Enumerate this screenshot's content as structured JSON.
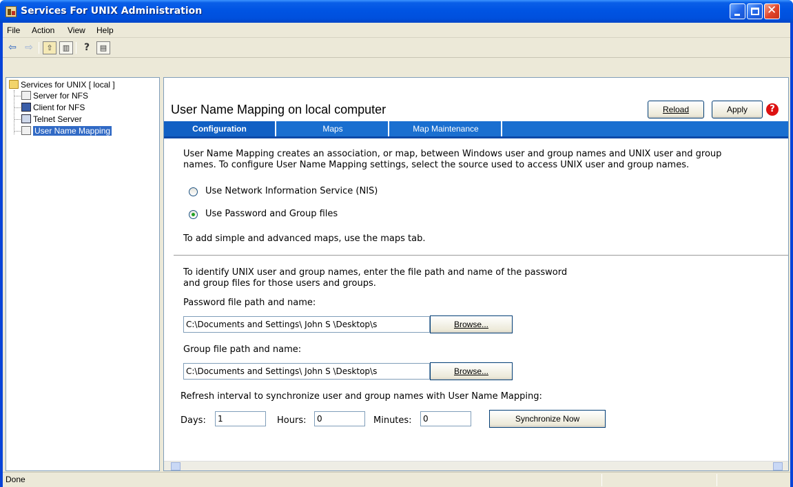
{
  "window": {
    "title": "Services For UNIX Administration"
  },
  "menubar": {
    "items": [
      "File",
      "Action",
      "View",
      "Help"
    ]
  },
  "toolbar": {
    "icons": [
      "back-arrow-icon",
      "forward-arrow-icon",
      "up-folder-icon",
      "show-hide-tree-icon",
      "help-icon",
      "action-pane-icon"
    ]
  },
  "tree": {
    "root": "Services for UNIX [ local ]",
    "items": [
      "Server for NFS",
      "Client for NFS",
      "Telnet Server",
      "User Name Mapping"
    ],
    "selected": "User Name Mapping"
  },
  "panel": {
    "title": "User Name Mapping on local computer",
    "reload_label": "Reload",
    "apply_label": "Apply",
    "tabs": [
      "Configuration",
      "Maps",
      "Map Maintenance"
    ],
    "active_tab": "Configuration",
    "intro_line1": "User Name Mapping creates an association, or map, between Windows user and group names and UNIX user and group",
    "intro_line2": "names. To configure User Name Mapping settings, select the source used to access UNIX user and group names.",
    "radio_nis": "Use Network Information Service (NIS)",
    "radio_files": "Use Password and Group files",
    "radio_selected": "files",
    "maps_hint": "To add simple and advanced maps, use the maps tab.",
    "files_line1": "To identify UNIX user and group names, enter the file path and name of the password",
    "files_line2": "and group files for those users and groups.",
    "password_label": "Password file path and name:",
    "password_value": "C:\\Documents and Settings\\ John S \\Desktop\\s",
    "group_label": "Group file path and name:",
    "group_value": "C:\\Documents and Settings\\ John S  \\Desktop\\s",
    "browse_label": "Browse...",
    "refresh_label": "Refresh interval to synchronize user and group names with User Name Mapping:",
    "days_label": "Days:",
    "days_value": "1",
    "hours_label": "Hours:",
    "hours_value": "0",
    "minutes_label": "Minutes:",
    "minutes_value": "0",
    "sync_label": "Synchronize Now"
  },
  "status": {
    "text": "Done"
  },
  "colors": {
    "titlebar": "#0054e3",
    "tabstrip": "#1a6fd0",
    "selection": "#316ac5",
    "help": "#dd1111"
  }
}
